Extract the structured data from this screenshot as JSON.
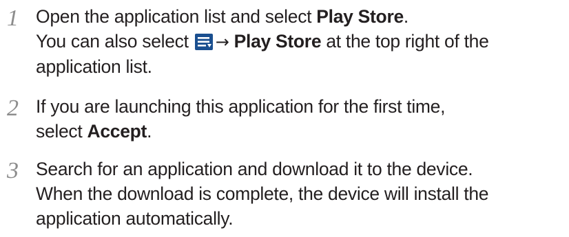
{
  "steps": [
    {
      "number": "1",
      "line1": {
        "pre": "Open the application list and select ",
        "bold": "Play Store",
        "post": "."
      },
      "line2": {
        "pre": "You can also select ",
        "arrow": "→",
        "bold": "Play Store",
        "post": " at the top right of the"
      },
      "line3": "application list.",
      "icon": "menu-list-icon"
    },
    {
      "number": "2",
      "line1": "If you are launching this application for the first time,",
      "line2": {
        "pre": "select ",
        "bold": "Accept",
        "post": "."
      }
    },
    {
      "number": "3",
      "line1": "Search for an application and download it to the device.",
      "line2": "When the download is complete, the device will install the",
      "line3": "application automatically."
    }
  ],
  "colors": {
    "text": "#231f20",
    "step_number": "#8c8c8c",
    "icon_blue": "#1a4f8f"
  }
}
